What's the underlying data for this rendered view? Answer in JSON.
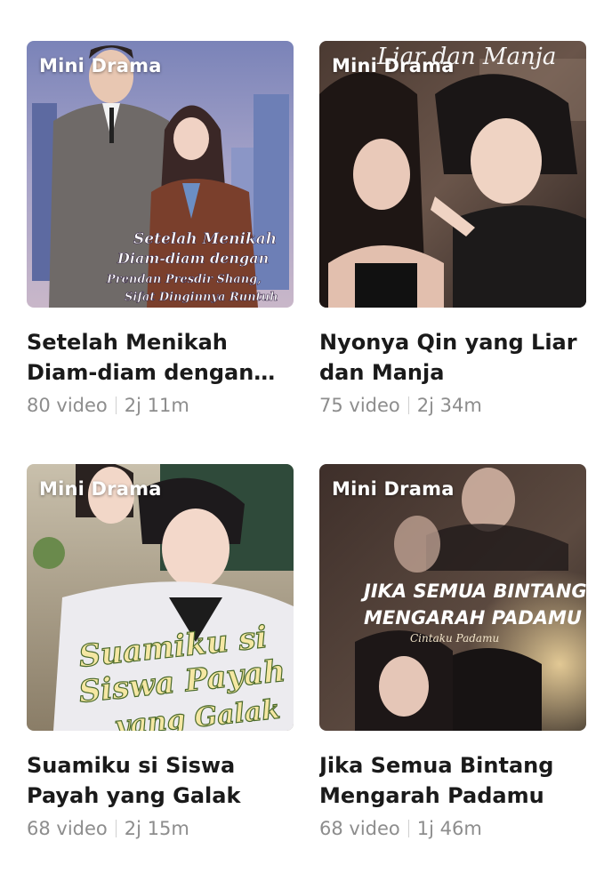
{
  "cards": [
    {
      "badge": "Mini Drama",
      "poster_text": [
        "Setelah Menikah",
        "Diam-diam dengan",
        "Prendan Presdir Shang,",
        "Sifat Dinginnya Runtuh"
      ],
      "title": "Setelah Menikah Diam-diam dengan P...",
      "episodes": "80 video",
      "duration": "2j 11m"
    },
    {
      "badge": "Mini Drama",
      "poster_text": [
        "Liar dan Manja"
      ],
      "title": "Nyonya Qin yang Liar dan Manja",
      "episodes": "75 video",
      "duration": "2j 34m"
    },
    {
      "badge": "Mini Drama",
      "poster_text": [
        "Suamiku si",
        "Siswa Payah",
        "yang Galak"
      ],
      "title": "Suamiku si Siswa Payah yang Galak",
      "episodes": "68 video",
      "duration": "2j 15m"
    },
    {
      "badge": "Mini Drama",
      "poster_text": [
        "JIKA SEMUA BINTANG",
        "MENGARAH PADAMU",
        "Cintaku Padamu"
      ],
      "title": "Jika Semua Bintang Mengarah Padamu",
      "episodes": "68 video",
      "duration": "1j 46m"
    }
  ]
}
